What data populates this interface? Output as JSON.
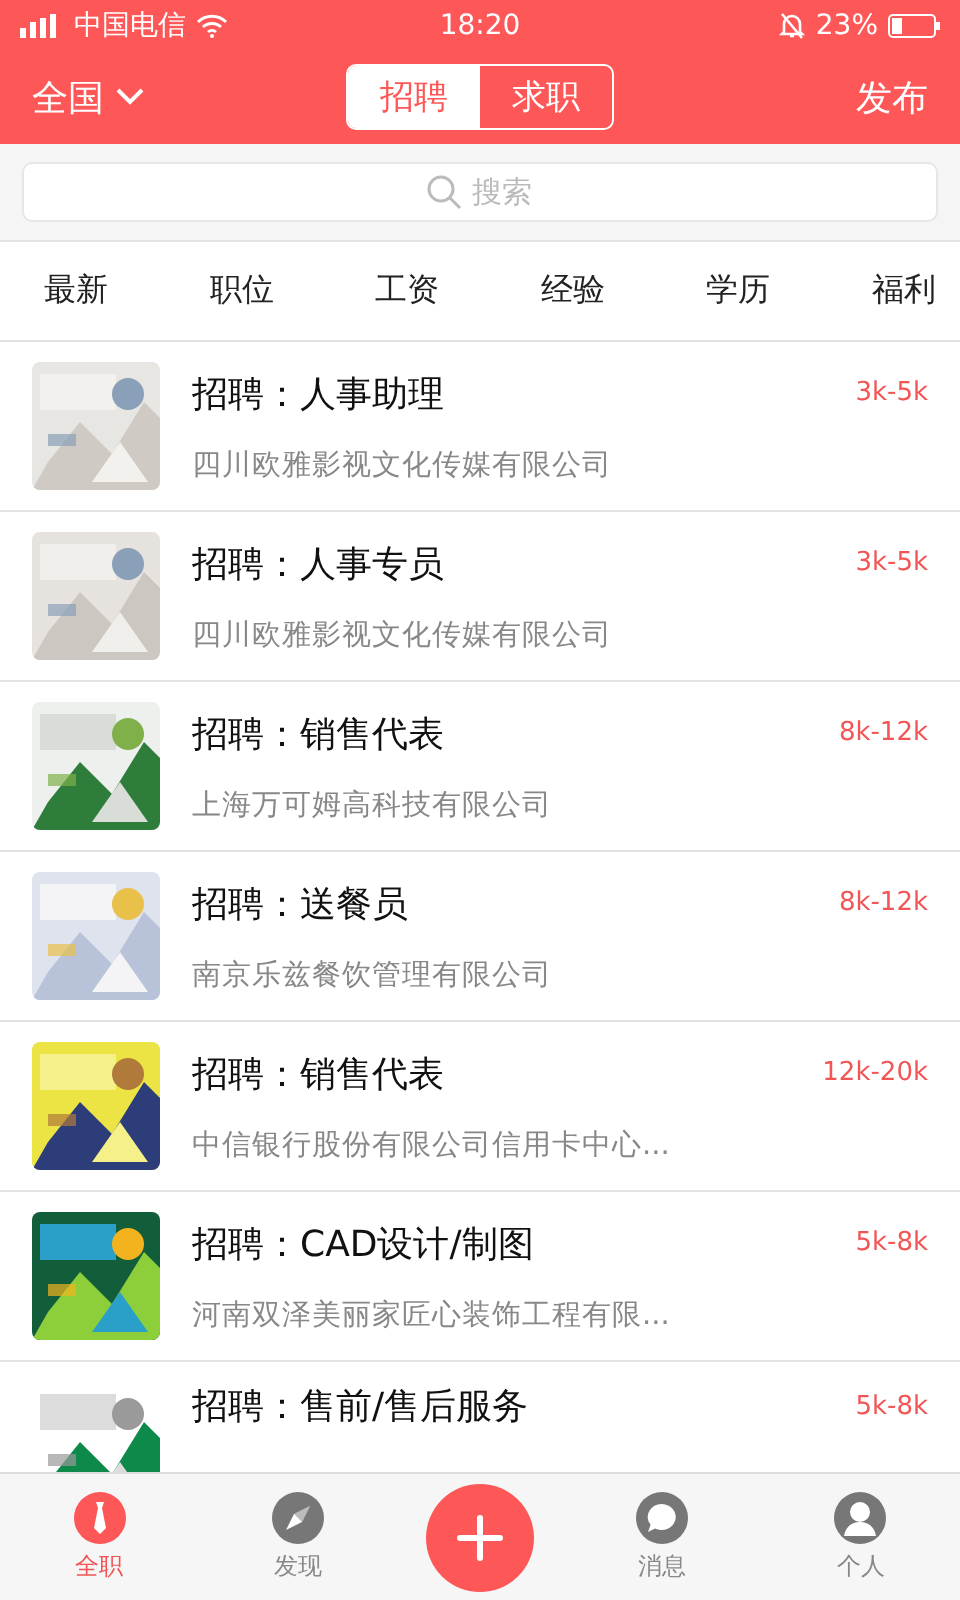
{
  "status_bar": {
    "carrier": "中国电信",
    "time": "18:20",
    "battery": "23%"
  },
  "header": {
    "region": "全国",
    "tabs": [
      {
        "label": "招聘",
        "selected": true
      },
      {
        "label": "求职",
        "selected": false
      }
    ],
    "action": "发布"
  },
  "search": {
    "placeholder": "搜索"
  },
  "filters": [
    "最新",
    "职位",
    "工资",
    "经验",
    "学历",
    "福利"
  ],
  "jobs": [
    {
      "title": "招聘：人事助理",
      "salary": "3k-5k",
      "company": "四川欧雅影视文化传媒有限公司"
    },
    {
      "title": "招聘：人事专员",
      "salary": "3k-5k",
      "company": "四川欧雅影视文化传媒有限公司"
    },
    {
      "title": "招聘：销售代表",
      "salary": "8k-12k",
      "company": "上海万可姆高科技有限公司"
    },
    {
      "title": "招聘：送餐员",
      "salary": "8k-12k",
      "company": "南京乐兹餐饮管理有限公司"
    },
    {
      "title": "招聘：销售代表",
      "salary": "12k-20k",
      "company": "中信银行股份有限公司信用卡中心..."
    },
    {
      "title": "招聘：CAD设计/制图",
      "salary": "5k-8k",
      "company": "河南双泽美丽家匠心装饰工程有限..."
    },
    {
      "title": "招聘：售前/售后服务",
      "salary": "5k-8k"
    }
  ],
  "bottom_nav": [
    {
      "label": "全职",
      "kind": "tie",
      "selected": true
    },
    {
      "label": "发现",
      "kind": "compass",
      "selected": false
    },
    {
      "kind": "plus"
    },
    {
      "label": "消息",
      "kind": "chat",
      "selected": false
    },
    {
      "label": "个人",
      "kind": "person",
      "selected": false
    }
  ]
}
